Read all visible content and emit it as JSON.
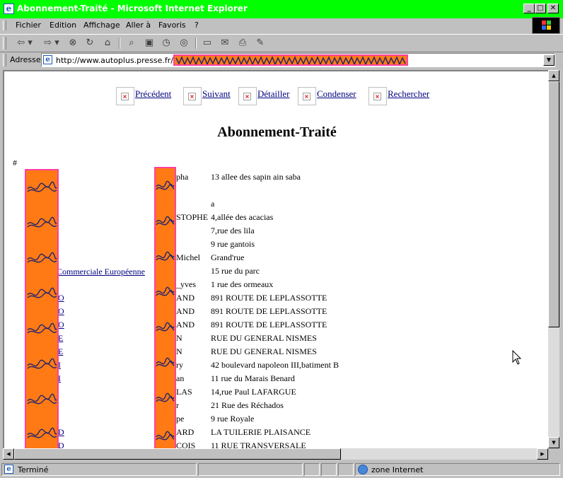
{
  "window": {
    "title": "Abonnement-Traité - Microsoft Internet Explorer",
    "controls": {
      "minimize": "_",
      "maximize": "□",
      "close": "✕"
    }
  },
  "menu": [
    "Fichier",
    "Edition",
    "Affichage",
    "Aller à",
    "Favoris",
    "?"
  ],
  "toolbar": {
    "icons": [
      "back-icon",
      "forward-icon",
      "stop-icon",
      "refresh-icon",
      "home-icon",
      "search-icon",
      "favorites-icon",
      "history-icon",
      "channels-icon",
      "fullscreen-icon",
      "mail-icon",
      "print-icon",
      "edit-icon"
    ]
  },
  "address": {
    "label": "Adresse",
    "url": "http://www.autoplus.presse.fr/ema"
  },
  "page": {
    "nav": [
      "Précédent",
      "Suivant",
      "Détailler",
      "Condenser",
      "Rechercher"
    ],
    "heading": "Abonnement-Traité",
    "hash": "#",
    "company_link": "Commerciale Européenne",
    "rows": [
      {
        "c1": "",
        "name": "pha",
        "addr": "13 allee des sapin ain saba"
      },
      {
        "c1": "",
        "name": "",
        "addr": ""
      },
      {
        "c1": "",
        "name": "",
        "addr": "a"
      },
      {
        "c1": "",
        "name": "STOPHE",
        "addr": "4,allée des acacias"
      },
      {
        "c1": "",
        "name": "",
        "addr": "7,rue des lila"
      },
      {
        "c1": "",
        "name": "",
        "addr": "9 rue gantois"
      },
      {
        "c1": "",
        "name": "Michel",
        "addr": "Grand'rue"
      },
      {
        "c1": "",
        "name": "",
        "addr": "15 rue du parc"
      },
      {
        "c1": "",
        "name": "_yves",
        "addr": "1 rue des ormeaux"
      },
      {
        "c1": "O",
        "name": "AND",
        "addr": "891 ROUTE DE LEPLASSOTTE"
      },
      {
        "c1": "O",
        "name": "AND",
        "addr": "891 ROUTE DE LEPLASSOTTE"
      },
      {
        "c1": "O",
        "name": "AND",
        "addr": "891 ROUTE DE LEPLASSOTTE"
      },
      {
        "c1": "E",
        "name": "N",
        "addr": "RUE DU GENERAL NISMES"
      },
      {
        "c1": "E",
        "name": "N",
        "addr": "RUE DU GENERAL NISMES"
      },
      {
        "c1": "I",
        "name": "ry",
        "addr": "42 boulevard napoleon III,batiment B"
      },
      {
        "c1": "I",
        "name": "an",
        "addr": "11 rue du Marais Benard"
      },
      {
        "c1": "",
        "name": "LAS",
        "addr": "14,rue Paul LAFARGUE"
      },
      {
        "c1": "",
        "name": "r",
        "addr": "21 Rue des Réchados"
      },
      {
        "c1": "",
        "name": "pe",
        "addr": "9 rue Royale"
      },
      {
        "c1": "D",
        "name": "ARD",
        "addr": "LA TUILERIE PLAISANCE"
      },
      {
        "c1": "D",
        "name": "COIS",
        "addr": "11 RUE TRANSVERSALE"
      }
    ]
  },
  "status": {
    "text": "Terminé",
    "zone": "zone Internet"
  },
  "colors": {
    "titlebar": "#00ff00",
    "redaction_fill": "#ff7a14",
    "redaction_border": "#ff40a0",
    "link": "#000080"
  }
}
